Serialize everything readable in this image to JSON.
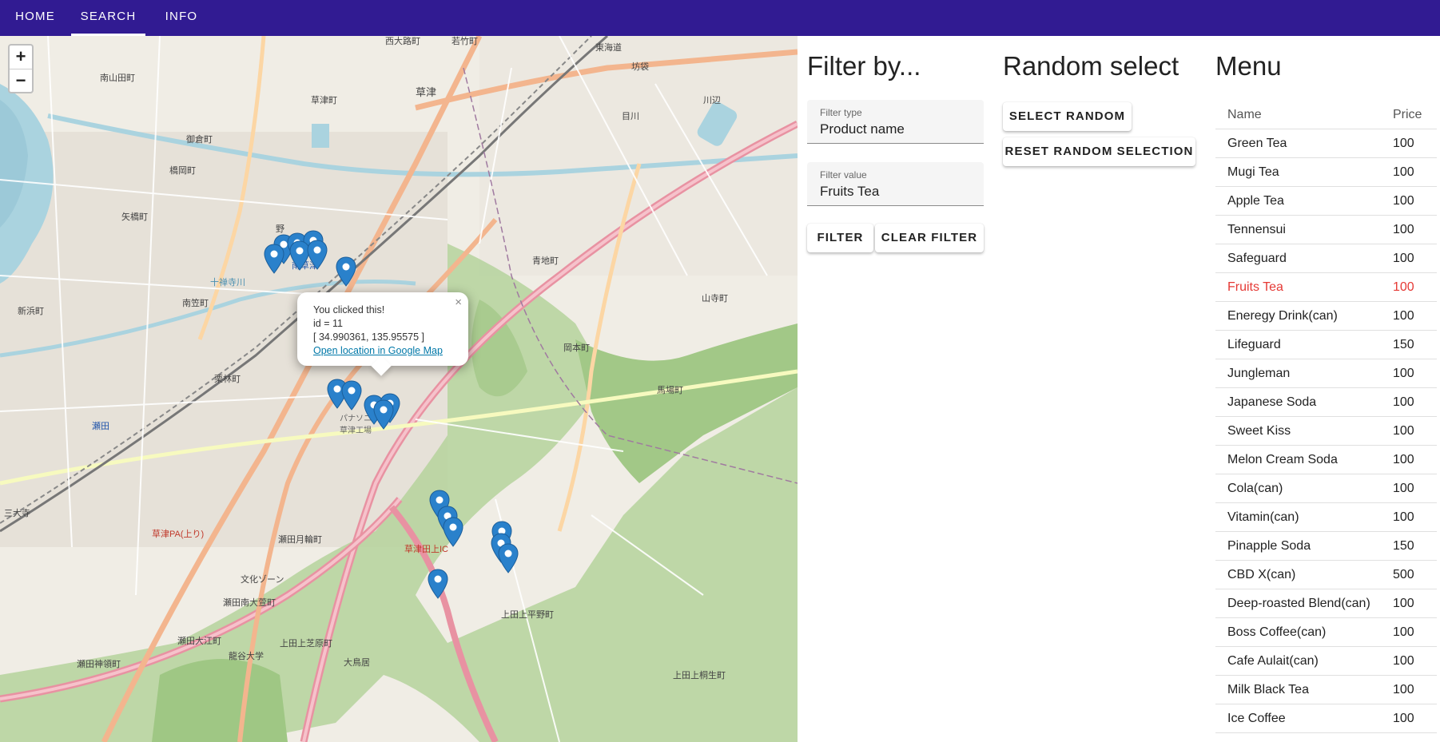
{
  "nav": {
    "tabs": [
      "HOME",
      "SEARCH",
      "INFO"
    ],
    "active": "SEARCH"
  },
  "map": {
    "zoom_in": "+",
    "zoom_out": "−",
    "popup": {
      "line1": "You clicked this!",
      "line2": "id = 11",
      "line3": "[ 34.990361, 135.95575 ]",
      "link": "Open location in Google Map",
      "close": "×"
    },
    "labels": [
      "西大路町",
      "若竹町",
      "東海道",
      "坊袋",
      "南山田町",
      "草津町",
      "草津",
      "川辺",
      "目川",
      "御倉町",
      "橋岡町",
      "矢橋町",
      "野",
      "南草津",
      "青地町",
      "山寺町",
      "南笠町",
      "十禅寺川",
      "新浜町",
      "岡本町",
      "栗林町",
      "馬場町",
      "瀬田",
      "パナソニック草津工場",
      "瀬田月輪町",
      "文化ゾーン",
      "瀬田南大萱町",
      "瀬田大江町",
      "龍谷大学",
      "上田上芝原町",
      "上田上平野町",
      "大鳥居",
      "瀬田神領町",
      "三大寺",
      "草津田上IC",
      "草津PA(上り)",
      "上田上桐生町"
    ],
    "marker_color": "#2a81cb"
  },
  "filter": {
    "title": "Filter by...",
    "type_label": "Filter type",
    "type_value": "Product name",
    "value_label": "Filter value",
    "value_value": "Fruits Tea",
    "filter_button": "FILTER",
    "clear_button": "CLEAR FILTER"
  },
  "random": {
    "title": "Random select",
    "select_button": "SELECT RANDOM",
    "reset_button": "RESET RANDOM SELECTION"
  },
  "menu": {
    "title": "Menu",
    "col_name": "Name",
    "col_price": "Price",
    "selected_color": "#e53935",
    "items": [
      {
        "name": "Green Tea",
        "price": "100"
      },
      {
        "name": "Mugi Tea",
        "price": "100"
      },
      {
        "name": "Apple Tea",
        "price": "100"
      },
      {
        "name": "Tennensui",
        "price": "100"
      },
      {
        "name": "Safeguard",
        "price": "100"
      },
      {
        "name": "Fruits Tea",
        "price": "100",
        "selected": true
      },
      {
        "name": "Eneregy Drink(can)",
        "price": "100"
      },
      {
        "name": "Lifeguard",
        "price": "150"
      },
      {
        "name": "Jungleman",
        "price": "100"
      },
      {
        "name": "Japanese Soda",
        "price": "100"
      },
      {
        "name": "Sweet Kiss",
        "price": "100"
      },
      {
        "name": "Melon Cream Soda",
        "price": "100"
      },
      {
        "name": "Cola(can)",
        "price": "100"
      },
      {
        "name": "Vitamin(can)",
        "price": "100"
      },
      {
        "name": "Pinapple Soda",
        "price": "150"
      },
      {
        "name": "CBD X(can)",
        "price": "500"
      },
      {
        "name": "Deep-roasted Blend(can)",
        "price": "100"
      },
      {
        "name": "Boss Coffee(can)",
        "price": "100"
      },
      {
        "name": "Cafe Aulait(can)",
        "price": "100"
      },
      {
        "name": "Milk Black Tea",
        "price": "100"
      },
      {
        "name": "Ice Coffee",
        "price": "100"
      }
    ]
  }
}
